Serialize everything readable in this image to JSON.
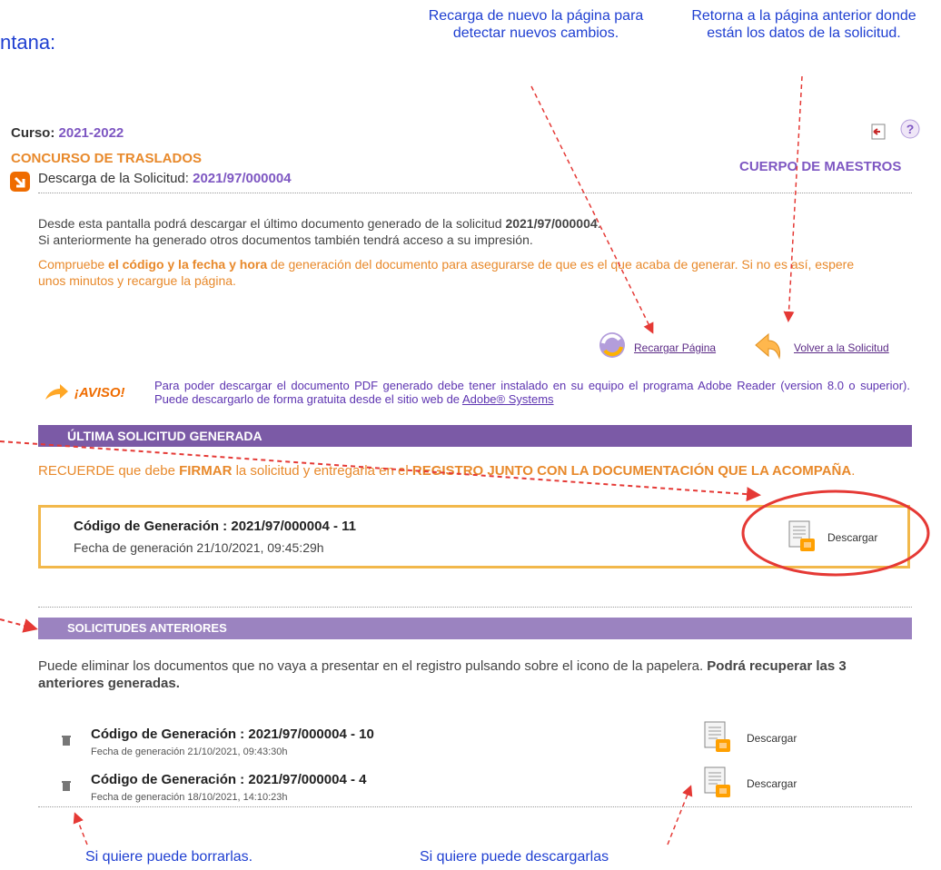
{
  "header_fragment": "ntana:",
  "annotations": {
    "reload": "Recarga de nuevo la página para detectar nuevos cambios.",
    "return": "Retorna a la página anterior donde están los datos de la solicitud.",
    "delete": "Si quiere puede borrarlas.",
    "download": "Si quiere puede descargarlas"
  },
  "course": {
    "label": "Curso:",
    "value": "2021-2022"
  },
  "contest_title": "CONCURSO DE TRASLADOS",
  "body_title": "CUERPO DE MAESTROS",
  "section": {
    "label": "Descarga de la Solicitud:",
    "id": "2021/97/000004"
  },
  "intro": {
    "line1_pre": "Desde esta pantalla podrá descargar el último documento generado de la solicitud ",
    "line1_id": "2021/97/000004",
    "line1_post": ".",
    "line2": "Si anteriormente ha generado otros documentos también tendrá acceso a su impresión."
  },
  "warning": {
    "pre": "Compruebe ",
    "bold": "el código y la fecha y hora",
    "post": " de generación del documento para asegurarse de que es el que acaba de generar. Si no es así, espere unos minutos y recargue la página."
  },
  "actions": {
    "reload": "Recargar Página",
    "back": "Volver a la Solicitud"
  },
  "aviso": {
    "label": "¡AVISO!",
    "text": "Para poder descargar el documento PDF generado debe tener instalado en su equipo el programa Adobe Reader (version 8.0 o superior). Puede descargarlo de forma gratuita desde el sitio web de ",
    "link": "Adobe® Systems"
  },
  "last": {
    "header": "ÚLTIMA SOLICITUD GENERADA",
    "reminder_pre": "RECUERDE que debe ",
    "reminder_bold1": "FIRMAR",
    "reminder_mid": " la solicitud y entregarla en el ",
    "reminder_bold2": "REGISTRO JUNTO CON LA DOCUMENTACIÓN QUE LA ACOMPAÑA",
    "reminder_post": ".",
    "code": "Código de Generación : 2021/97/000004 - 11",
    "date": "Fecha de generación 21/10/2021, 09:45:29h",
    "download": "Descargar"
  },
  "previous": {
    "header": "SOLICITUDES ANTERIORES",
    "note_pre": "Puede eliminar los documentos que no vaya a presentar en el registro pulsando sobre el icono de la papelera. ",
    "note_bold": "Podrá recuperar las 3 anteriores generadas.",
    "items": [
      {
        "code": "Código de Generación : 2021/97/000004 - 10",
        "date": "Fecha de generación 21/10/2021, 09:43:30h",
        "download": "Descargar"
      },
      {
        "code": "Código de Generación : 2021/97/000004 - 4",
        "date": "Fecha de generación 18/10/2021, 14:10:23h",
        "download": "Descargar"
      }
    ]
  }
}
